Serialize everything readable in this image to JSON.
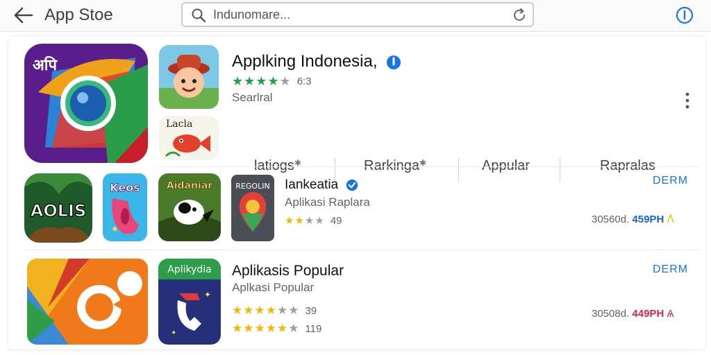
{
  "header": {
    "title": "App Stoe",
    "search_placeholder": "Indunomare...",
    "icons": {
      "back": "arrow-left-icon",
      "search": "search-icon",
      "refresh": "refresh-icon",
      "info": "info-icon"
    }
  },
  "featured": {
    "name": "Applking Indonesia,",
    "stars": "★★★★★",
    "rating": "6:3",
    "subtitle": "Searlral",
    "secondary_icon_label": "Lacla",
    "tabs": [
      "latiogs",
      "Rarkinga",
      "Appular",
      "Rapralas"
    ],
    "icons": {
      "main": "camera-lens-rocket-icon",
      "game": "cartoon-character-icon",
      "fish": "red-fish-icon",
      "verified": "verified-badge-icon",
      "more": "more-vert-icon"
    }
  },
  "row1": {
    "tiles": [
      {
        "label": "AOLIS",
        "icon": "jungle-text-icon"
      },
      {
        "label": "Keos",
        "icon": "pink-shoe-icon"
      },
      {
        "label": "Aidaniar",
        "icon": "jungle-animal-icon"
      },
      {
        "label": "REGOLIN",
        "icon": "map-pin-icon"
      }
    ],
    "name": "Iankeatia",
    "subtitle": "Aplikasi Raplara",
    "stars": "★★★★★",
    "rating": "49",
    "open_label": "DERM",
    "meta_prefix": "30560d.",
    "meta_highlight": "459PH",
    "meta_color": "#1a5fd0"
  },
  "row2": {
    "tiles": [
      {
        "label": "",
        "icon": "orange-play-shape-icon"
      },
      {
        "label": "Aplikydia",
        "icon": "phone-call-icon"
      }
    ],
    "name": "Aplikasis Popular",
    "subtitle": "Aplkasi Popular",
    "stars_a": "★★★★★",
    "rating_a": "39",
    "stars_b": "★★★★★",
    "rating_b": "119",
    "open_label": "DERM",
    "meta_prefix": "30508d.",
    "meta_highlight": "449PH",
    "meta_color": "#d0264a"
  },
  "colors": {
    "accent_blue": "#1a73e8",
    "star_green": "#21a446",
    "star_gold": "#f2b705",
    "star_gray": "#9aa0a6"
  }
}
